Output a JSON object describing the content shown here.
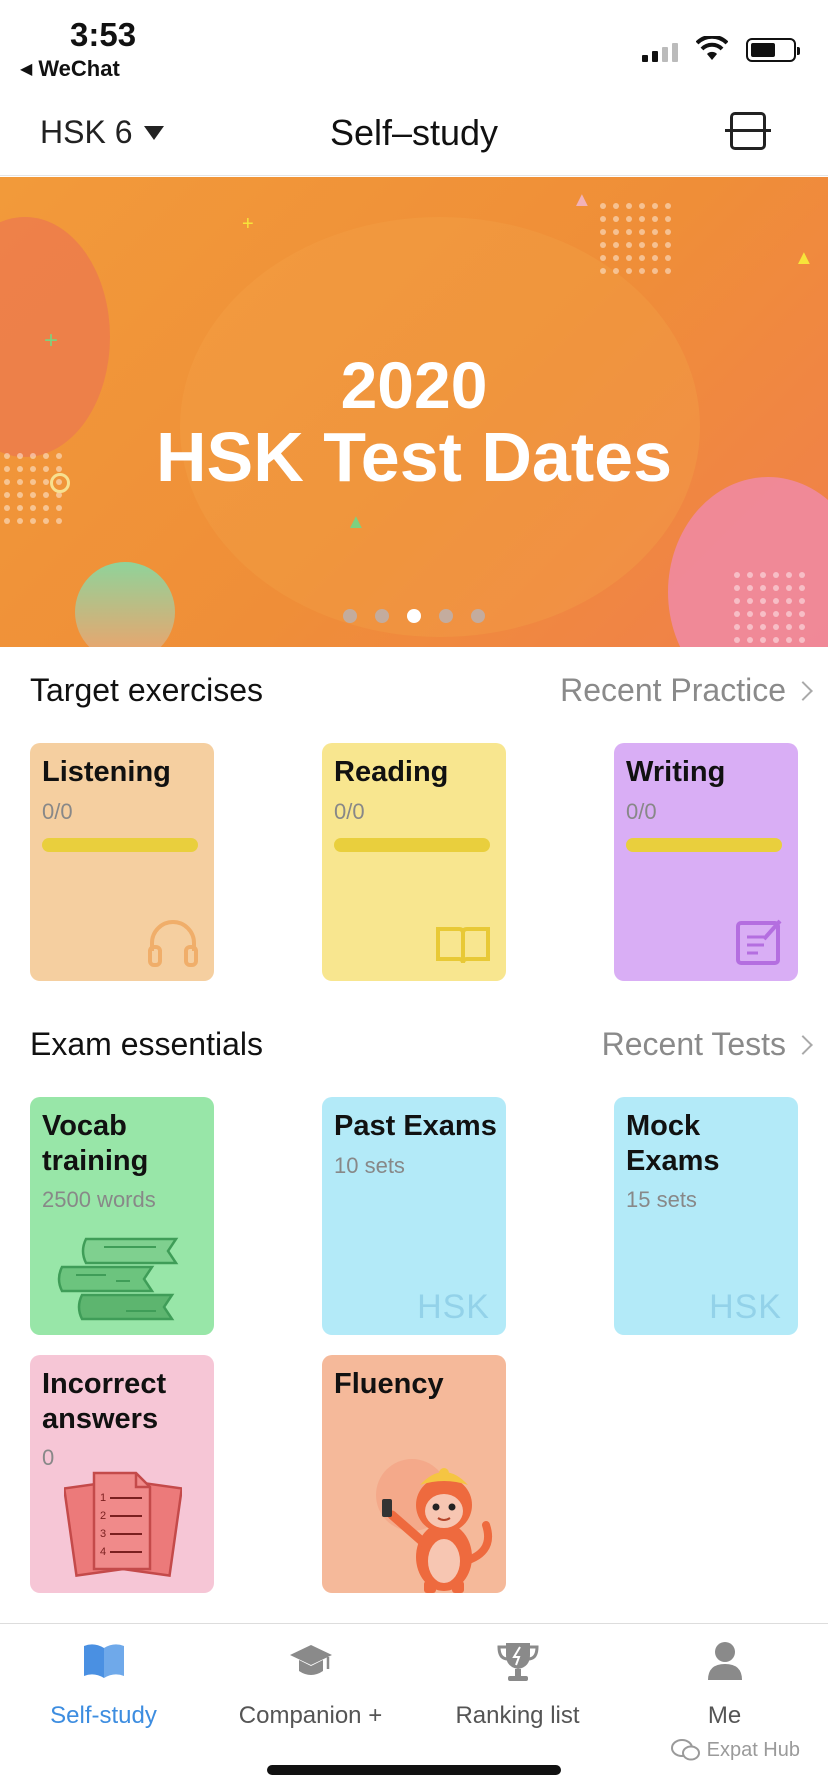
{
  "status_bar": {
    "time": "3:53",
    "back_app": "WeChat"
  },
  "header": {
    "level": "HSK 6",
    "title": "Self–study"
  },
  "banner": {
    "year": "2020",
    "headline": "HSK Test Dates",
    "page_count": 5,
    "active_page": 3
  },
  "target_exercises": {
    "title": "Target exercises",
    "link": "Recent Practice",
    "cards": [
      {
        "label": "Listening",
        "progress": "0/0",
        "color": "#f5cfa0",
        "icon": "headphones-icon"
      },
      {
        "label": "Reading",
        "progress": "0/0",
        "color": "#f8e68f",
        "icon": "book-icon"
      },
      {
        "label": "Writing",
        "progress": "0/0",
        "color": "#d9aef5",
        "icon": "edit-icon"
      }
    ]
  },
  "exam_essentials": {
    "title": "Exam essentials",
    "link": "Recent Tests",
    "cards": [
      {
        "label": "Vocab training",
        "sub": "2500  words",
        "color": "#98e6a8",
        "icon": "book-stack-icon"
      },
      {
        "label": "Past Exams",
        "sub": "10 sets",
        "color": "#b3eaf8",
        "mark": "HSK"
      },
      {
        "label": "Mock Exams",
        "sub": "15 sets",
        "color": "#b3eaf8",
        "mark": "HSK"
      },
      {
        "label": "Incorrect answers",
        "sub": "0",
        "color": "#f6c6d6",
        "icon": "answer-sheet-icon"
      },
      {
        "label": "Fluency",
        "color": "#f5b99a",
        "icon": "monkey-mascot-icon"
      }
    ]
  },
  "tabbar": {
    "items": [
      {
        "label": "Self-study",
        "active": true,
        "icon": "book-icon"
      },
      {
        "label": "Companion +",
        "active": false,
        "icon": "graduation-cap-icon"
      },
      {
        "label": "Ranking list",
        "active": false,
        "icon": "trophy-icon"
      },
      {
        "label": "Me",
        "active": false,
        "icon": "person-icon"
      }
    ]
  },
  "watermark": "Expat Hub",
  "colors": {
    "accent": "#3d8de0",
    "banner": "#ef8e38",
    "progress_bar": "#e9cf3d"
  }
}
